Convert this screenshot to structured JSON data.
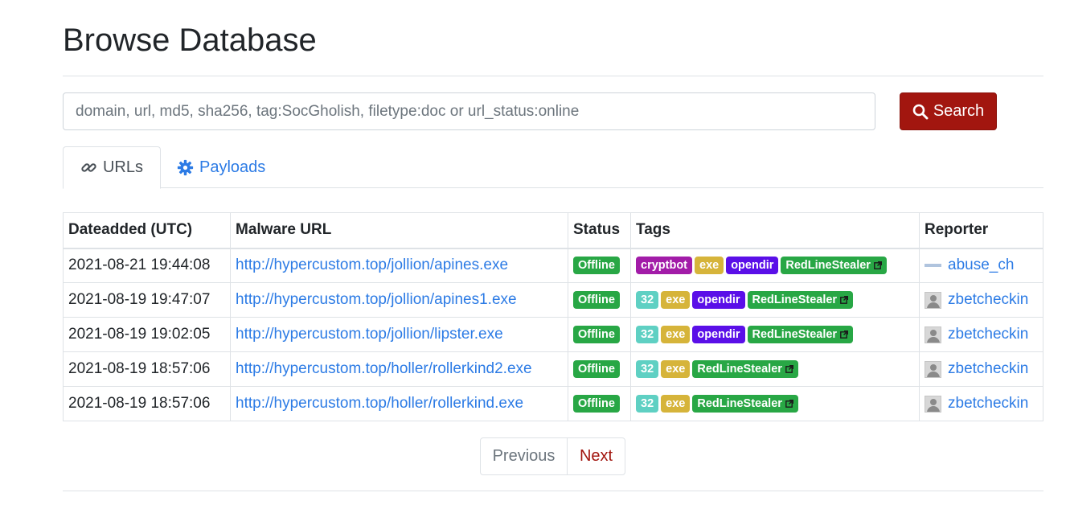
{
  "page": {
    "title": "Browse Database"
  },
  "search": {
    "placeholder": "domain, url, md5, sha256, tag:SocGholish, filetype:doc or url_status:online",
    "value": "",
    "button_label": "Search"
  },
  "tabs": [
    {
      "label": "URLs",
      "icon": "link-icon",
      "active": true
    },
    {
      "label": "Payloads",
      "icon": "gear-icon",
      "active": false
    }
  ],
  "table": {
    "headers": [
      "Dateadded (UTC)",
      "Malware URL",
      "Status",
      "Tags",
      "Reporter"
    ],
    "rows": [
      {
        "date": "2021-08-21 19:44:08",
        "url": "http://hypercustom.top/jollion/apines.exe",
        "status": "Offline",
        "tags": [
          {
            "label": "cryptbot",
            "kind": "cryptbot"
          },
          {
            "label": "exe",
            "kind": "exe"
          },
          {
            "label": "opendir",
            "kind": "opendir"
          },
          {
            "label": "RedLineStealer",
            "kind": "red",
            "external": true
          }
        ],
        "reporter": "abuse_ch",
        "avatar": "abuse"
      },
      {
        "date": "2021-08-19 19:47:07",
        "url": "http://hypercustom.top/jollion/apines1.exe",
        "status": "Offline",
        "tags": [
          {
            "label": "32",
            "kind": "32"
          },
          {
            "label": "exe",
            "kind": "exe"
          },
          {
            "label": "opendir",
            "kind": "opendir"
          },
          {
            "label": "RedLineStealer",
            "kind": "red",
            "external": true
          }
        ],
        "reporter": "zbetcheckin",
        "avatar": "default"
      },
      {
        "date": "2021-08-19 19:02:05",
        "url": "http://hypercustom.top/jollion/lipster.exe",
        "status": "Offline",
        "tags": [
          {
            "label": "32",
            "kind": "32"
          },
          {
            "label": "exe",
            "kind": "exe"
          },
          {
            "label": "opendir",
            "kind": "opendir"
          },
          {
            "label": "RedLineStealer",
            "kind": "red",
            "external": true
          }
        ],
        "reporter": "zbetcheckin",
        "avatar": "default"
      },
      {
        "date": "2021-08-19 18:57:06",
        "url": "http://hypercustom.top/holler/rollerkind2.exe",
        "status": "Offline",
        "tags": [
          {
            "label": "32",
            "kind": "32"
          },
          {
            "label": "exe",
            "kind": "exe"
          },
          {
            "label": "RedLineStealer",
            "kind": "red",
            "external": true
          }
        ],
        "reporter": "zbetcheckin",
        "avatar": "default"
      },
      {
        "date": "2021-08-19 18:57:06",
        "url": "http://hypercustom.top/holler/rollerkind.exe",
        "status": "Offline",
        "tags": [
          {
            "label": "32",
            "kind": "32"
          },
          {
            "label": "exe",
            "kind": "exe"
          },
          {
            "label": "RedLineStealer",
            "kind": "red",
            "external": true
          }
        ],
        "reporter": "zbetcheckin",
        "avatar": "default"
      }
    ]
  },
  "pagination": {
    "previous": "Previous",
    "next": "Next"
  },
  "colors": {
    "accent": "#a2160f",
    "link": "#2c7be5",
    "offline": "#28a745"
  }
}
